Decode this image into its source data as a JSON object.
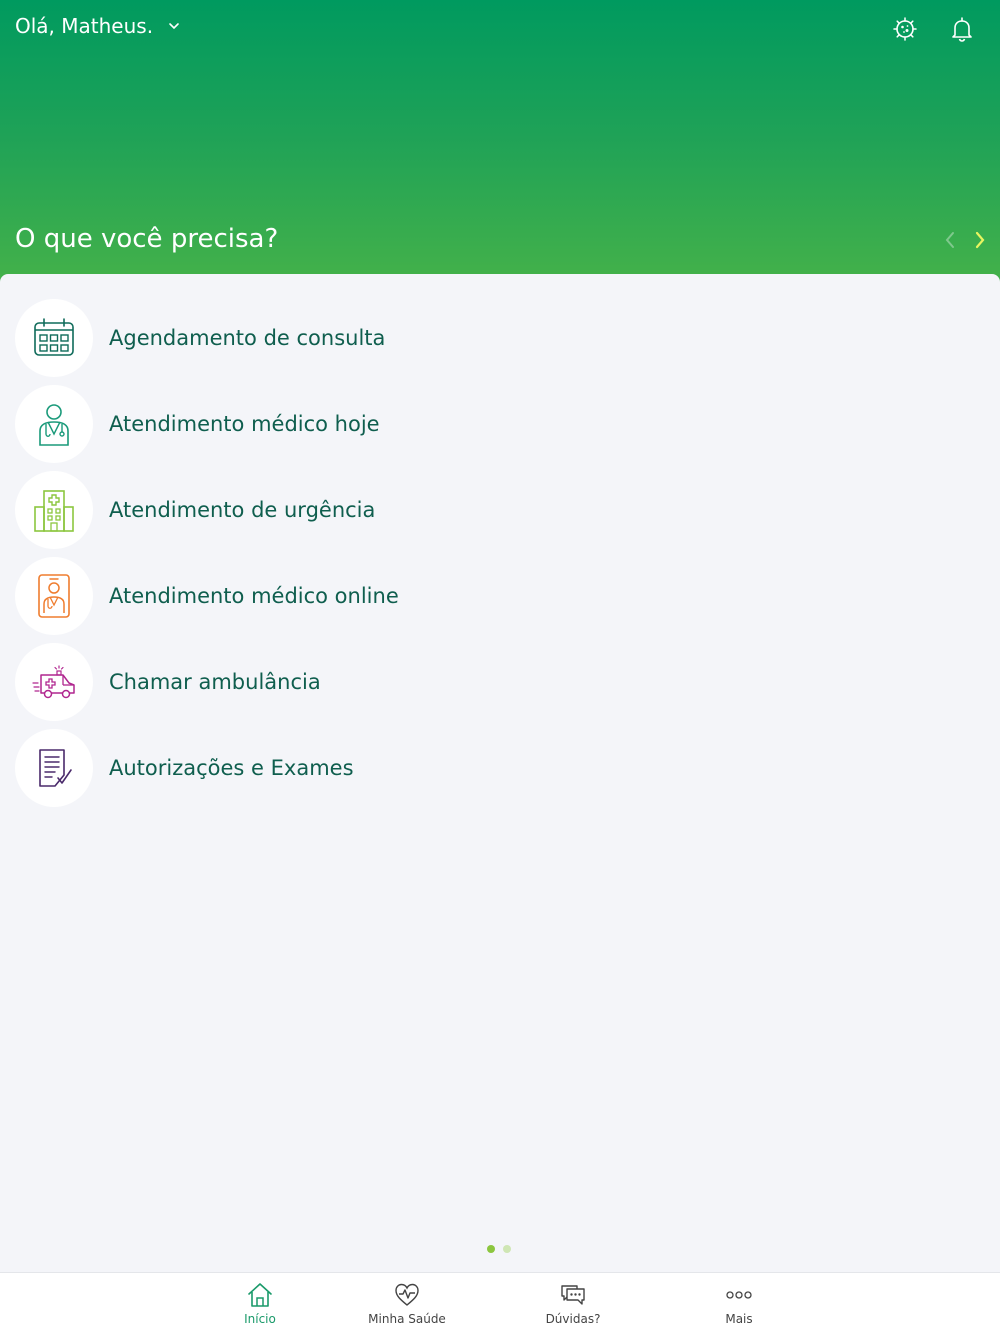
{
  "header": {
    "greeting": "Olá, Matheus.",
    "headline": "O que você precisa?"
  },
  "icons": {
    "dropdown": "chevron-down-icon",
    "virus": "virus-icon",
    "notifications": "bell-icon",
    "prev": "chevron-left-icon",
    "next": "chevron-right-icon"
  },
  "menu": {
    "items": [
      {
        "label": "Agendamento de consulta",
        "icon": "calendar-icon",
        "color": "#0f6b5a"
      },
      {
        "label": "Atendimento médico hoje",
        "icon": "doctor-icon",
        "color": "#1a9a7a"
      },
      {
        "label": "Atendimento de urgência",
        "icon": "hospital-icon",
        "color": "#8cc63f"
      },
      {
        "label": "Atendimento médico online",
        "icon": "doctor-phone-icon",
        "color": "#ef7d2f"
      },
      {
        "label": "Chamar ambulância",
        "icon": "ambulance-icon",
        "color": "#b0268f"
      },
      {
        "label": "Autorizações e Exames",
        "icon": "document-check-icon",
        "color": "#4a2a6b"
      }
    ]
  },
  "pager": {
    "active_color": "#8cc63f",
    "inactive_color": "#cfe6b4"
  },
  "tabbar": {
    "tabs": [
      {
        "label": "Início",
        "icon": "home-icon",
        "active": true
      },
      {
        "label": "Minha Saúde",
        "icon": "heart-pulse-icon",
        "active": false
      },
      {
        "label": "Dúvidas?",
        "icon": "chat-bubbles-icon",
        "active": false
      },
      {
        "label": "Mais",
        "icon": "more-circles-icon",
        "active": false
      }
    ],
    "active_color": "#1a9a6a",
    "inactive_color": "#444444"
  },
  "colors": {
    "header_top": "#009a5f",
    "header_bottom": "#48b348",
    "label_text": "#0f5e4e",
    "background": "#f4f5f9"
  }
}
